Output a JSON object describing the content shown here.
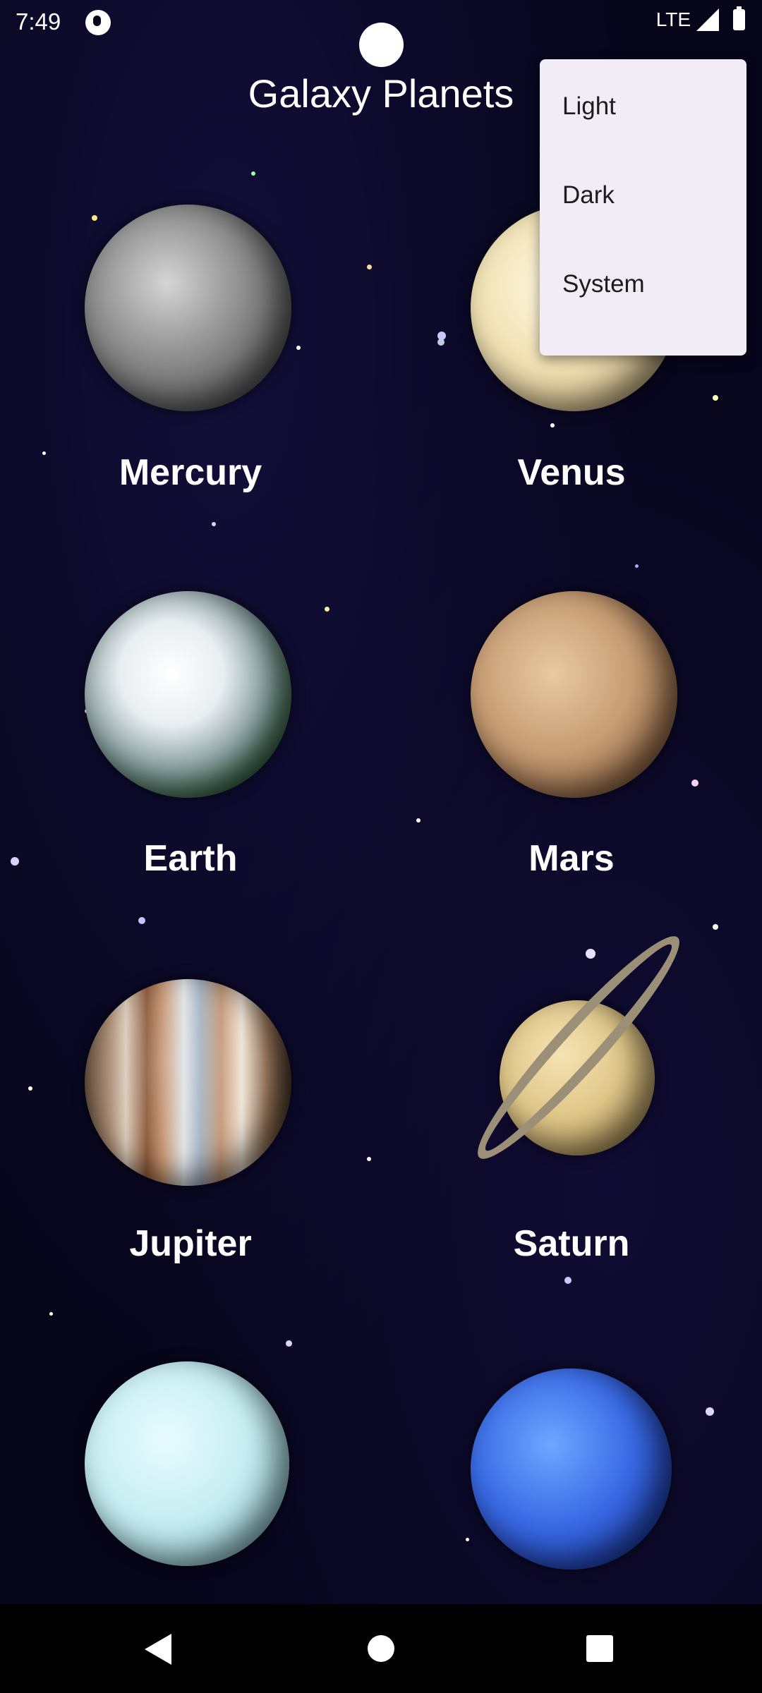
{
  "status_bar": {
    "time": "7:49",
    "network": "LTE",
    "icons": [
      "app-notification-icon",
      "signal-icon",
      "battery-icon"
    ]
  },
  "app_bar": {
    "title": "Galaxy Planets"
  },
  "planets": [
    {
      "name": "Mercury",
      "icon": "mercury-icon"
    },
    {
      "name": "Venus",
      "icon": "venus-icon"
    },
    {
      "name": "Earth",
      "icon": "earth-icon"
    },
    {
      "name": "Mars",
      "icon": "mars-icon"
    },
    {
      "name": "Jupiter",
      "icon": "jupiter-icon"
    },
    {
      "name": "Saturn",
      "icon": "saturn-icon"
    },
    {
      "name": "",
      "icon": "uranus-icon"
    },
    {
      "name": "",
      "icon": "neptune-icon"
    }
  ],
  "theme_menu": {
    "items": [
      "Light",
      "Dark",
      "System"
    ]
  },
  "nav_bar": {
    "icons": [
      "back-icon",
      "home-icon",
      "recents-icon"
    ]
  }
}
